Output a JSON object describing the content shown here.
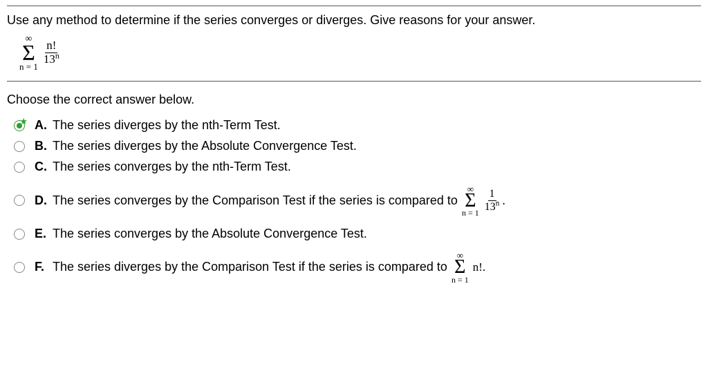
{
  "question": {
    "prompt": "Use any method to determine if the series converges or diverges. Give reasons for your answer.",
    "formula": {
      "upper": "∞",
      "lower": "n = 1",
      "numerator": "n!",
      "denominator_base": "13",
      "denominator_exp": "n"
    },
    "subprompt": "Choose the correct answer below."
  },
  "options": {
    "A": {
      "letter": "A.",
      "text": "The series diverges by the nth-Term Test.",
      "selected": true
    },
    "B": {
      "letter": "B.",
      "text": "The series diverges by the Absolute Convergence Test.",
      "selected": false
    },
    "C": {
      "letter": "C.",
      "text": "The series converges by the nth-Term Test.",
      "selected": false
    },
    "D": {
      "letter": "D.",
      "text": "The series converges by the Comparison Test if the series is compared to ",
      "selected": false,
      "tail_formula": {
        "upper": "∞",
        "lower": "n = 1",
        "numerator": "1",
        "denominator_base": "13",
        "denominator_exp": "n"
      }
    },
    "E": {
      "letter": "E.",
      "text": "The series converges by the Absolute Convergence Test.",
      "selected": false
    },
    "F": {
      "letter": "F.",
      "text": "The series diverges by the Comparison Test if the series is compared to ",
      "selected": false,
      "tail_simple": {
        "upper": "∞",
        "lower": "n = 1",
        "term": "n!."
      }
    }
  }
}
